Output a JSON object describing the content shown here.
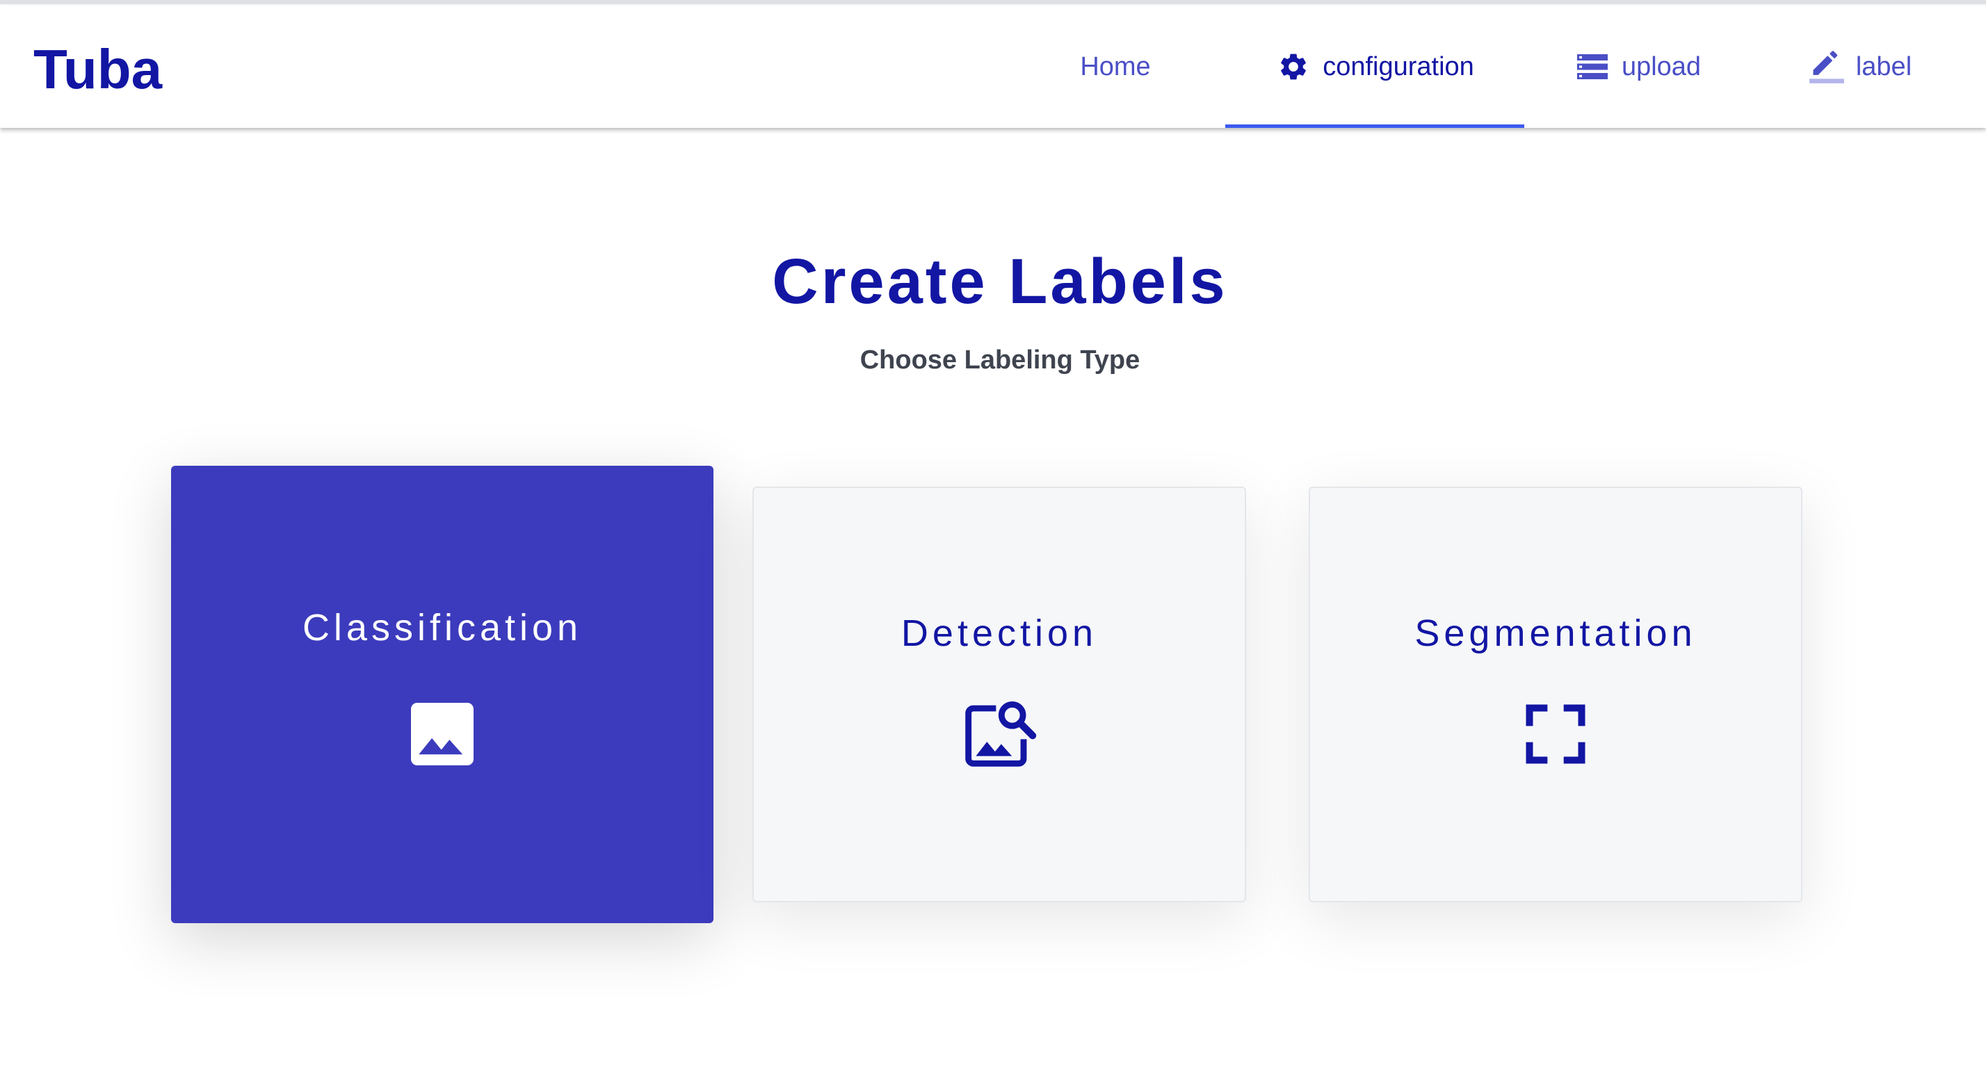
{
  "app": {
    "brand": "Tuba"
  },
  "nav": {
    "items": [
      {
        "label": "Home",
        "icon": null,
        "active": false
      },
      {
        "label": "configuration",
        "icon": "gear-icon",
        "active": true
      },
      {
        "label": "upload",
        "icon": "storage-list-icon",
        "active": false
      },
      {
        "label": "label",
        "icon": "pencil-icon",
        "active": false
      }
    ]
  },
  "main": {
    "title": "Create Labels",
    "subtitle": "Choose Labeling Type",
    "cards": [
      {
        "label": "Classification",
        "icon": "image-icon",
        "selected": true
      },
      {
        "label": "Detection",
        "icon": "image-search-icon",
        "selected": false
      },
      {
        "label": "Segmentation",
        "icon": "crop-free-icon",
        "selected": false
      }
    ]
  },
  "colors": {
    "brand": "#1216a3",
    "nav_text": "#4a4fc6",
    "active_indicator": "#3d5af1",
    "selected_card": "#3c3bbd",
    "card_background": "#f6f7f9",
    "subtitle_text": "#3f444f"
  }
}
